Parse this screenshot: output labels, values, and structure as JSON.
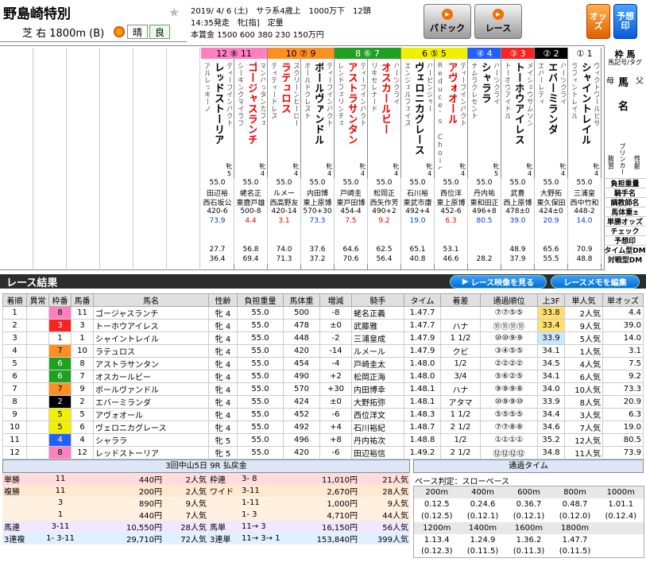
{
  "header": {
    "race_name": "野島崎特別",
    "course": "芝 右 1800m (B)",
    "weather": "晴",
    "going": "良",
    "info_line1": "2019/ 4/ 6 (土)　サラ系4歳上　1000万下　12頭",
    "info_line2": "14:35発走　牝[指]　定量",
    "info_line3": "本賞金 1500 600 380 230 150万円",
    "buttons": {
      "paddock": "パドック",
      "race": "レース",
      "odds": "オッズ",
      "yoso": "予想印"
    },
    "corner_label": "枠 馬",
    "sub_label": "馬記号/タグ",
    "mother_label": "母",
    "father_label": "父",
    "horse_label_1": "馬",
    "horse_label_2": "名",
    "breeder_label": "ブリンカー",
    "leg_label": "脚質",
    "sex_age_label": "性齢"
  },
  "colors": {
    "frame1": "#ffffff",
    "frame2": "#000000",
    "frame3": "#ff2020",
    "frame4": "#2060ff",
    "frame5": "#f0f000",
    "frame6": "#20a020",
    "frame7": "#ff9020",
    "frame8": "#ff80c0",
    "accent_orange": "#f07000",
    "highlight_pink": "#ffb0b0",
    "highlight_blue": "#a0c8ff",
    "highlight_green": "#b0e0b0",
    "highlight_yellow": "#ffe070"
  },
  "entry_table": {
    "frame_headers": [
      {
        "nums": "12 ⑧ 11",
        "color": "#ff80c0"
      },
      {
        "nums": "10 ⑦ 9",
        "color": "#ff9020"
      },
      {
        "nums": "8 ⑥ 7",
        "color": "#20a020"
      },
      {
        "nums": "6 ⑤ 5",
        "color": "#f0f000"
      },
      {
        "nums": "④ 4",
        "color": "#2060ff"
      },
      {
        "nums": "③ 3",
        "color": "#ff2020"
      },
      {
        "nums": "② 2",
        "color": "#000000"
      },
      {
        "nums": "① 1",
        "color": "#ffffff"
      }
    ],
    "horses": [
      {
        "num": "12",
        "name": "レッドストーリア",
        "sire": "ディープインパクト",
        "dam": "アルレッキーノ",
        "sex_age": "牝5",
        "weight": "55.0",
        "jockey": "田辺裕",
        "trainer": "西石坂公",
        "body": "420-6",
        "odds": "73.9",
        "red": false,
        "t1": "27.7",
        "t2": "36.4"
      },
      {
        "num": "11",
        "name": "ゴージャスランチ",
        "sire": "マンハッタンカフェ",
        "dam": "シーキングマイラブ",
        "sex_age": "牝4",
        "weight": "55.0",
        "jockey": "蛯名正",
        "trainer": "東鹿戸雄",
        "body": "500-8",
        "odds": "4.4",
        "red": true,
        "t1": "56.8",
        "t2": "69.4"
      },
      {
        "num": "10",
        "name": "ラテュロス",
        "sire": "スクリーンヒーロー",
        "dam": "ティディードレス",
        "sex_age": "牝4",
        "weight": "55.0",
        "jockey": "ルメー",
        "trainer": "西高野友",
        "body": "420-14",
        "odds": "3.1",
        "red": true,
        "t1": "74.0",
        "t2": "71.3"
      },
      {
        "num": "9",
        "name": "ボールヴァンドル",
        "sire": "ディープインパクト",
        "dam": "ボールドクレスト",
        "sex_age": "牝4",
        "weight": "55.0",
        "jockey": "内田博",
        "trainer": "東上原博",
        "body": "570+30",
        "odds": "73.3",
        "red": false,
        "t1": "37.6",
        "t2": "37.2"
      },
      {
        "num": "8",
        "name": "アストラサンタン",
        "sire": "ディープインパクト",
        "dam": "レンドフェリンチェ",
        "sex_age": "牝4",
        "weight": "55.0",
        "jockey": "戸崎圭",
        "trainer": "東戸田博",
        "body": "454-4",
        "odds": "7.5",
        "red": true,
        "t1": "64.6",
        "t2": "70.6"
      },
      {
        "num": "7",
        "name": "オスカールビー",
        "sire": "ハーツクライ",
        "dam": "リキセレナード",
        "sex_age": "牝4",
        "weight": "55.0",
        "jockey": "松岡正",
        "trainer": "西矢作芳",
        "body": "490+2",
        "odds": "9.2",
        "red": true,
        "t1": "62.5",
        "t2": "56.4"
      },
      {
        "num": "6",
        "name": "ヴェロニカグレース",
        "sire": "ハービンジャー",
        "dam": "エンジェルフェイス",
        "sex_age": "牝4",
        "weight": "55.0",
        "jockey": "石川裕",
        "trainer": "東武市康",
        "body": "492+4",
        "odds": "19.0",
        "red": false,
        "t1": "65.1",
        "t2": "40.8"
      },
      {
        "num": "5",
        "name": "アヴォオール",
        "sire": "ディープインパクト",
        "dam": "Reduce's Choice",
        "sex_age": "牝4",
        "weight": "55.0",
        "jockey": "西位洋",
        "trainer": "東上原博",
        "body": "452-6",
        "odds": "6.3",
        "red": true,
        "t1": "53.1",
        "t2": "46.6"
      },
      {
        "num": "4",
        "name": "シャララ",
        "sire": "ハーツクライ",
        "dam": "ナムラクレセント",
        "sex_age": "牝5",
        "weight": "55.0",
        "jockey": "丹内祐",
        "trainer": "東和田正",
        "body": "496+8",
        "odds": "80.5",
        "red": false,
        "t1": "",
        "t2": "28.2"
      },
      {
        "num": "3",
        "name": "トーホウアイレス",
        "sire": "メイショウサムソン",
        "dam": "トーホウアイドル",
        "sex_age": "牝4",
        "weight": "55.0",
        "jockey": "武豊",
        "trainer": "西上原博",
        "body": "478±0",
        "odds": "39.0",
        "red": false,
        "t1": "48.9",
        "t2": "37.9"
      },
      {
        "num": "2",
        "name": "エバーミランダ",
        "sire": "ハーツクライ",
        "dam": "エバーレディ",
        "sex_age": "牝4",
        "weight": "55.0",
        "jockey": "大野拓",
        "trainer": "東久保田",
        "body": "424±0",
        "odds": "20.9",
        "red": false,
        "t1": "65.6",
        "t2": "55.5"
      },
      {
        "num": "1",
        "name": "シャイントレイル",
        "sire": "ヴィクトワールピサ",
        "dam": "ラフィントレイル",
        "sex_age": "牝4",
        "weight": "55.0",
        "jockey": "三浦皇",
        "trainer": "西中竹和",
        "body": "448-2",
        "odds": "14.0",
        "red": false,
        "t1": "70.9",
        "t2": "48.8"
      }
    ],
    "row_labels": [
      "負担重量",
      "騎手名",
      "調教師名",
      "馬体重±",
      "単勝オッズ",
      "チェック",
      "予想印",
      "タイム型DM",
      "対戦型DM"
    ]
  },
  "results": {
    "band_title": "レース結果",
    "video_btn": "レース映像を見る",
    "memo_btn": "レースメモを編集",
    "columns": [
      "着順",
      "異常",
      "枠番",
      "馬番",
      "馬名",
      "性齢",
      "負担重量",
      "馬体重",
      "増減",
      "騎手",
      "タイム",
      "着差",
      "通過順位",
      "上3F",
      "単人気",
      "単オッズ"
    ],
    "rows": [
      {
        "rank": "1",
        "frame": "8",
        "num": "11",
        "name": "ゴージャスランチ",
        "sex": "牝 4",
        "wt": "55.0",
        "body": "500",
        "diff": "-8",
        "jockey": "蛯名正義",
        "time": "1.47.7",
        "margin": "",
        "pass": "⑦⑦⑤⑤",
        "last3f": "33.8",
        "pop": "2人気",
        "odds": "4.4"
      },
      {
        "rank": "2",
        "frame": "3",
        "num": "3",
        "name": "トーホウアイレス",
        "sex": "牝 4",
        "wt": "55.0",
        "body": "478",
        "diff": "±0",
        "jockey": "武藤雅",
        "time": "1.47.7",
        "margin": "ハナ",
        "pass": "⑪⑪⑪⑪",
        "last3f": "33.4",
        "pop": "9人気",
        "odds": "39.0"
      },
      {
        "rank": "3",
        "frame": "1",
        "num": "1",
        "name": "シャイントレイル",
        "sex": "牝 4",
        "wt": "55.0",
        "body": "448",
        "diff": "-2",
        "jockey": "三浦皇成",
        "time": "1.47.9",
        "margin": "1 1/2",
        "pass": "⑩⑩⑨⑨",
        "last3f": "33.9",
        "pop": "5人気",
        "odds": "14.0"
      },
      {
        "rank": "4",
        "frame": "7",
        "num": "10",
        "name": "ラテュロス",
        "sex": "牝 4",
        "wt": "55.0",
        "body": "420",
        "diff": "-14",
        "jockey": "ルメール",
        "time": "1.47.9",
        "margin": "クビ",
        "pass": "③④⑤⑤",
        "last3f": "34.1",
        "pop": "1人気",
        "odds": "3.1"
      },
      {
        "rank": "5",
        "frame": "6",
        "num": "8",
        "name": "アストラサンタン",
        "sex": "牝 4",
        "wt": "55.0",
        "body": "454",
        "diff": "-4",
        "jockey": "戸崎圭太",
        "time": "1.48.0",
        "margin": "1/2",
        "pass": "②②②②",
        "last3f": "34.5",
        "pop": "4人気",
        "odds": "7.5"
      },
      {
        "rank": "6",
        "frame": "6",
        "num": "7",
        "name": "オスカールビー",
        "sex": "牝 4",
        "wt": "55.0",
        "body": "490",
        "diff": "+2",
        "jockey": "松岡正海",
        "time": "1.48.0",
        "margin": "3/4",
        "pass": "⑤⑥②⑤",
        "last3f": "34.1",
        "pop": "6人気",
        "odds": "9.2"
      },
      {
        "rank": "7",
        "frame": "7",
        "num": "9",
        "name": "ボールヴァンドル",
        "sex": "牝 4",
        "wt": "55.0",
        "body": "570",
        "diff": "+30",
        "jockey": "内田博幸",
        "time": "1.48.1",
        "margin": "ハナ",
        "pass": "⑨⑨⑨⑧",
        "last3f": "34.0",
        "pop": "10人気",
        "odds": "73.3"
      },
      {
        "rank": "8",
        "frame": "2",
        "num": "2",
        "name": "エバーミランダ",
        "sex": "牝 4",
        "wt": "55.0",
        "body": "424",
        "diff": "±0",
        "jockey": "大野拓弥",
        "time": "1.48.1",
        "margin": "アタマ",
        "pass": "⑩⑨⑨⑩",
        "last3f": "33.9",
        "pop": "8人気",
        "odds": "20.9"
      },
      {
        "rank": "9",
        "frame": "5",
        "num": "5",
        "name": "アヴォオール",
        "sex": "牝 4",
        "wt": "55.0",
        "body": "452",
        "diff": "-6",
        "jockey": "西位洋文",
        "time": "1.48.3",
        "margin": "1 1/2",
        "pass": "⑤⑤⑤⑤",
        "last3f": "34.4",
        "pop": "3人気",
        "odds": "6.3"
      },
      {
        "rank": "10",
        "frame": "5",
        "num": "6",
        "name": "ヴェロニカグレース",
        "sex": "牝 4",
        "wt": "55.0",
        "body": "492",
        "diff": "+4",
        "jockey": "石川裕紀",
        "time": "1.48.7",
        "margin": "2 1/2",
        "pass": "⑦⑦⑧⑧",
        "last3f": "34.6",
        "pop": "7人気",
        "odds": "19.0"
      },
      {
        "rank": "11",
        "frame": "4",
        "num": "4",
        "name": "シャララ",
        "sex": "牝 5",
        "wt": "55.0",
        "body": "496",
        "diff": "+8",
        "jockey": "丹内祐次",
        "time": "1.48.8",
        "margin": "1/2",
        "pass": "①①①①",
        "last3f": "35.2",
        "pop": "12人気",
        "odds": "80.5"
      },
      {
        "rank": "12",
        "frame": "8",
        "num": "12",
        "name": "レッドストーリア",
        "sex": "牝 5",
        "wt": "55.0",
        "body": "420",
        "diff": "-6",
        "jockey": "田辺裕信",
        "time": "1.49.2",
        "margin": "2 1/2",
        "pass": "⑫⑫⑫⑫",
        "last3f": "34.8",
        "pop": "11人気",
        "odds": "73.9"
      }
    ]
  },
  "payout": {
    "title": "3回中山5日 9R 払戻金",
    "rows": [
      {
        "type": "単勝",
        "combo": "11",
        "amount": "440円",
        "pop": "2人気",
        "type2": "枠連",
        "combo2": "3- 8",
        "amount2": "11,010円",
        "pop2": "21人気"
      },
      {
        "type": "複勝",
        "combo": "11",
        "amount": "200円",
        "pop": "2人気",
        "type2": "ワイド",
        "combo2": "3-11",
        "amount2": "2,670円",
        "pop2": "28人気"
      },
      {
        "type": "",
        "combo": "3",
        "amount": "890円",
        "pop": "9人気",
        "type2": "",
        "combo2": "1-11",
        "amount2": "1,000円",
        "pop2": "9人気"
      },
      {
        "type": "",
        "combo": "1",
        "amount": "440円",
        "pop": "7人気",
        "type2": "",
        "combo2": "1- 3",
        "amount2": "4,710円",
        "pop2": "44人気"
      },
      {
        "type": "馬連",
        "combo": "3-11",
        "amount": "10,550円",
        "pop": "28人気",
        "type2": "馬単",
        "combo2": "11→ 3",
        "amount2": "16,150円",
        "pop2": "56人気"
      },
      {
        "type": "3連複",
        "combo": "1- 3-11",
        "amount": "29,710円",
        "pop": "72人気",
        "type2": "3連単",
        "combo2": "11→ 3→ 1",
        "amount2": "153,840円",
        "pop2": "399人気"
      }
    ]
  },
  "passing": {
    "title": "通過タイム",
    "pace": "ペース判定：スローペース",
    "header1": [
      "200m",
      "400m",
      "600m",
      "800m",
      "1000m"
    ],
    "row1": [
      "0.12.5",
      "0.24.6",
      "0.36.7",
      "0.48.7",
      "1.01.1"
    ],
    "row1b": [
      "(0.12.5)",
      "(0.12.1)",
      "(0.12.1)",
      "(0.12.0)",
      "(0.12.4)"
    ],
    "header2": [
      "1200m",
      "1400m",
      "1600m",
      "1800m"
    ],
    "row2": [
      "1.13.4",
      "1.24.9",
      "1.36.2",
      "1.47.7"
    ],
    "row2b": [
      "(0.12.3)",
      "(0.11.5)",
      "(0.11.3)",
      "(0.11.5)"
    ]
  }
}
